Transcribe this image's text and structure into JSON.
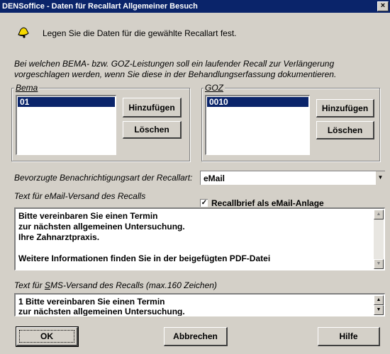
{
  "window": {
    "title": "DENSoffice - Daten für Recallart Allgemeiner Besuch",
    "close_label": "×"
  },
  "header": {
    "icon": "bell-icon",
    "text": "Legen Sie die Daten für die gewählte Recallart fest."
  },
  "description": {
    "line1": "Bei welchen BEMA- bzw. GOZ-Leistungen soll ein laufender Recall zur Verlängerung",
    "line2": "vorgeschlagen werden, wenn Sie diese in der Behandlungserfassung dokumentieren."
  },
  "bema": {
    "label": "Bema",
    "items": [
      "01"
    ],
    "add_label": "Hinzufügen",
    "delete_label": "Löschen"
  },
  "goz": {
    "label": "GOZ",
    "items": [
      "0010"
    ],
    "add_label": "Hinzufügen",
    "delete_label": "Löschen"
  },
  "notification": {
    "label": "Bevorzugte Benachrichtigungsart der Recallart:",
    "value": "eMail"
  },
  "email": {
    "label": "Text für eMail-Versand des Recalls",
    "attachment_label": "Recallbrief als eMail-Anlage",
    "attachment_checked": "✓",
    "lines": [
      "Bitte vereinbaren Sie einen Termin",
      "zur nächsten allgemeinen Untersuchung.",
      "Ihre Zahnarztpraxis.",
      "",
      "Weitere Informationen finden Sie in der beigefügten PDF-Datei"
    ]
  },
  "sms": {
    "label": "Text für SMS-Versand des Recalls (max.160 Zeichen)",
    "lines": [
      "1 Bitte vereinbaren Sie einen Termin",
      "zur nächsten allgemeinen Untersuchung."
    ]
  },
  "buttons": {
    "ok": "OK",
    "cancel": "Abbrechen",
    "help": "Hilfe"
  }
}
